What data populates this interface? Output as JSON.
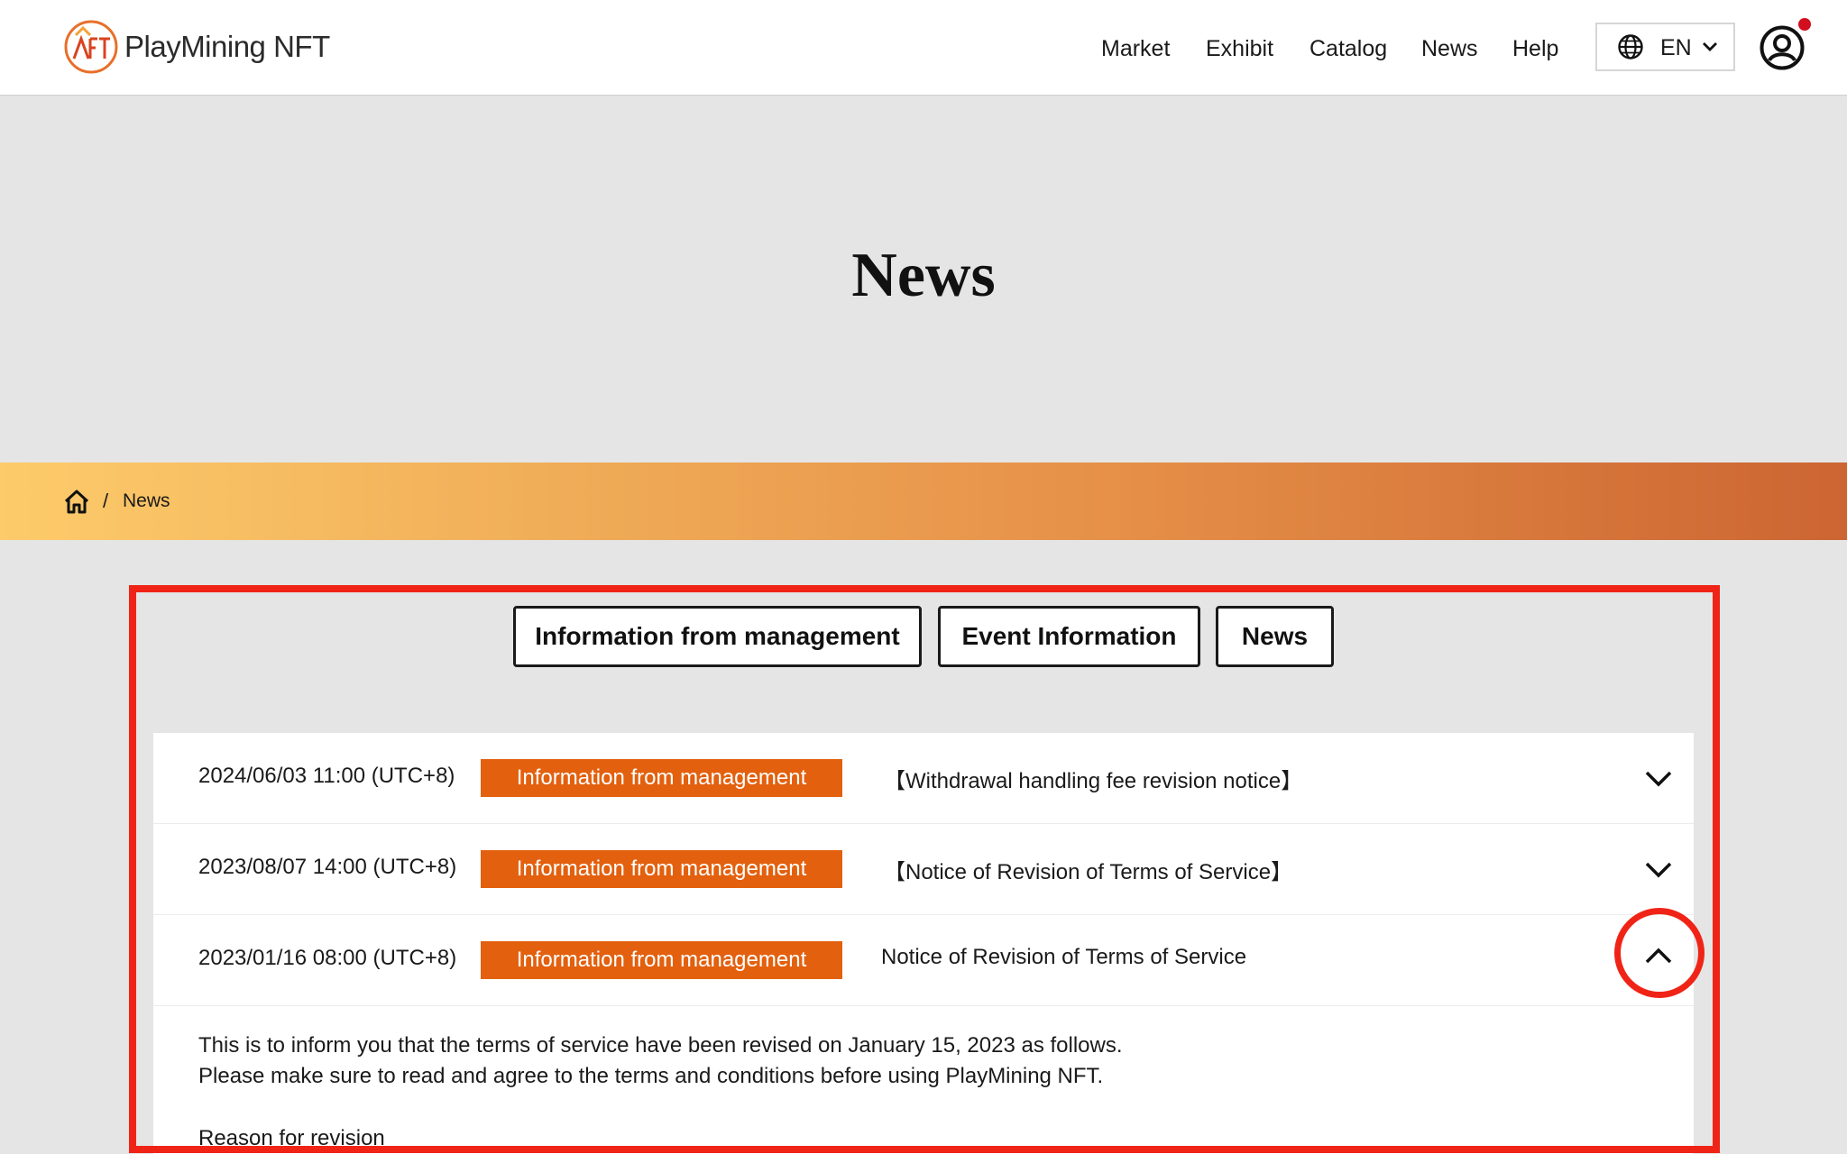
{
  "header": {
    "logo_text": "PlayMining NFT",
    "nav": [
      {
        "label": "Market"
      },
      {
        "label": "Exhibit"
      },
      {
        "label": "Catalog"
      },
      {
        "label": "News"
      },
      {
        "label": "Help"
      }
    ],
    "language": "EN",
    "notification_dot_color": "#d10f1f"
  },
  "hero": {
    "title": "News"
  },
  "breadcrumb": {
    "separator": "/",
    "current": "News"
  },
  "tabs": [
    {
      "label": "Information from management"
    },
    {
      "label": "Event Information"
    },
    {
      "label": "News"
    }
  ],
  "news": [
    {
      "date": "2024/06/03 11:00 (UTC+8)",
      "category": "Information from management",
      "title": "【Withdrawal handling fee revision notice】",
      "expanded": false
    },
    {
      "date": "2023/08/07 14:00 (UTC+8)",
      "category": "Information from management",
      "title": "【Notice of Revision of Terms of Service】",
      "expanded": false
    },
    {
      "date": "2023/01/16 08:00 (UTC+8)",
      "category": "Information from management",
      "title": "Notice of Revision of Terms of Service",
      "expanded": true
    }
  ],
  "expanded_body": {
    "line1": "This is to inform you that the terms of service have been revised on January 15, 2023 as follows.",
    "line2": "Please make sure to read and agree to the terms and conditions before using PlayMining NFT.",
    "line3": "Reason for revision"
  },
  "colors": {
    "accent": "#e3600e",
    "highlight": "#f02416",
    "band_start": "#fdcb6a",
    "band_end": "#cc6532"
  }
}
